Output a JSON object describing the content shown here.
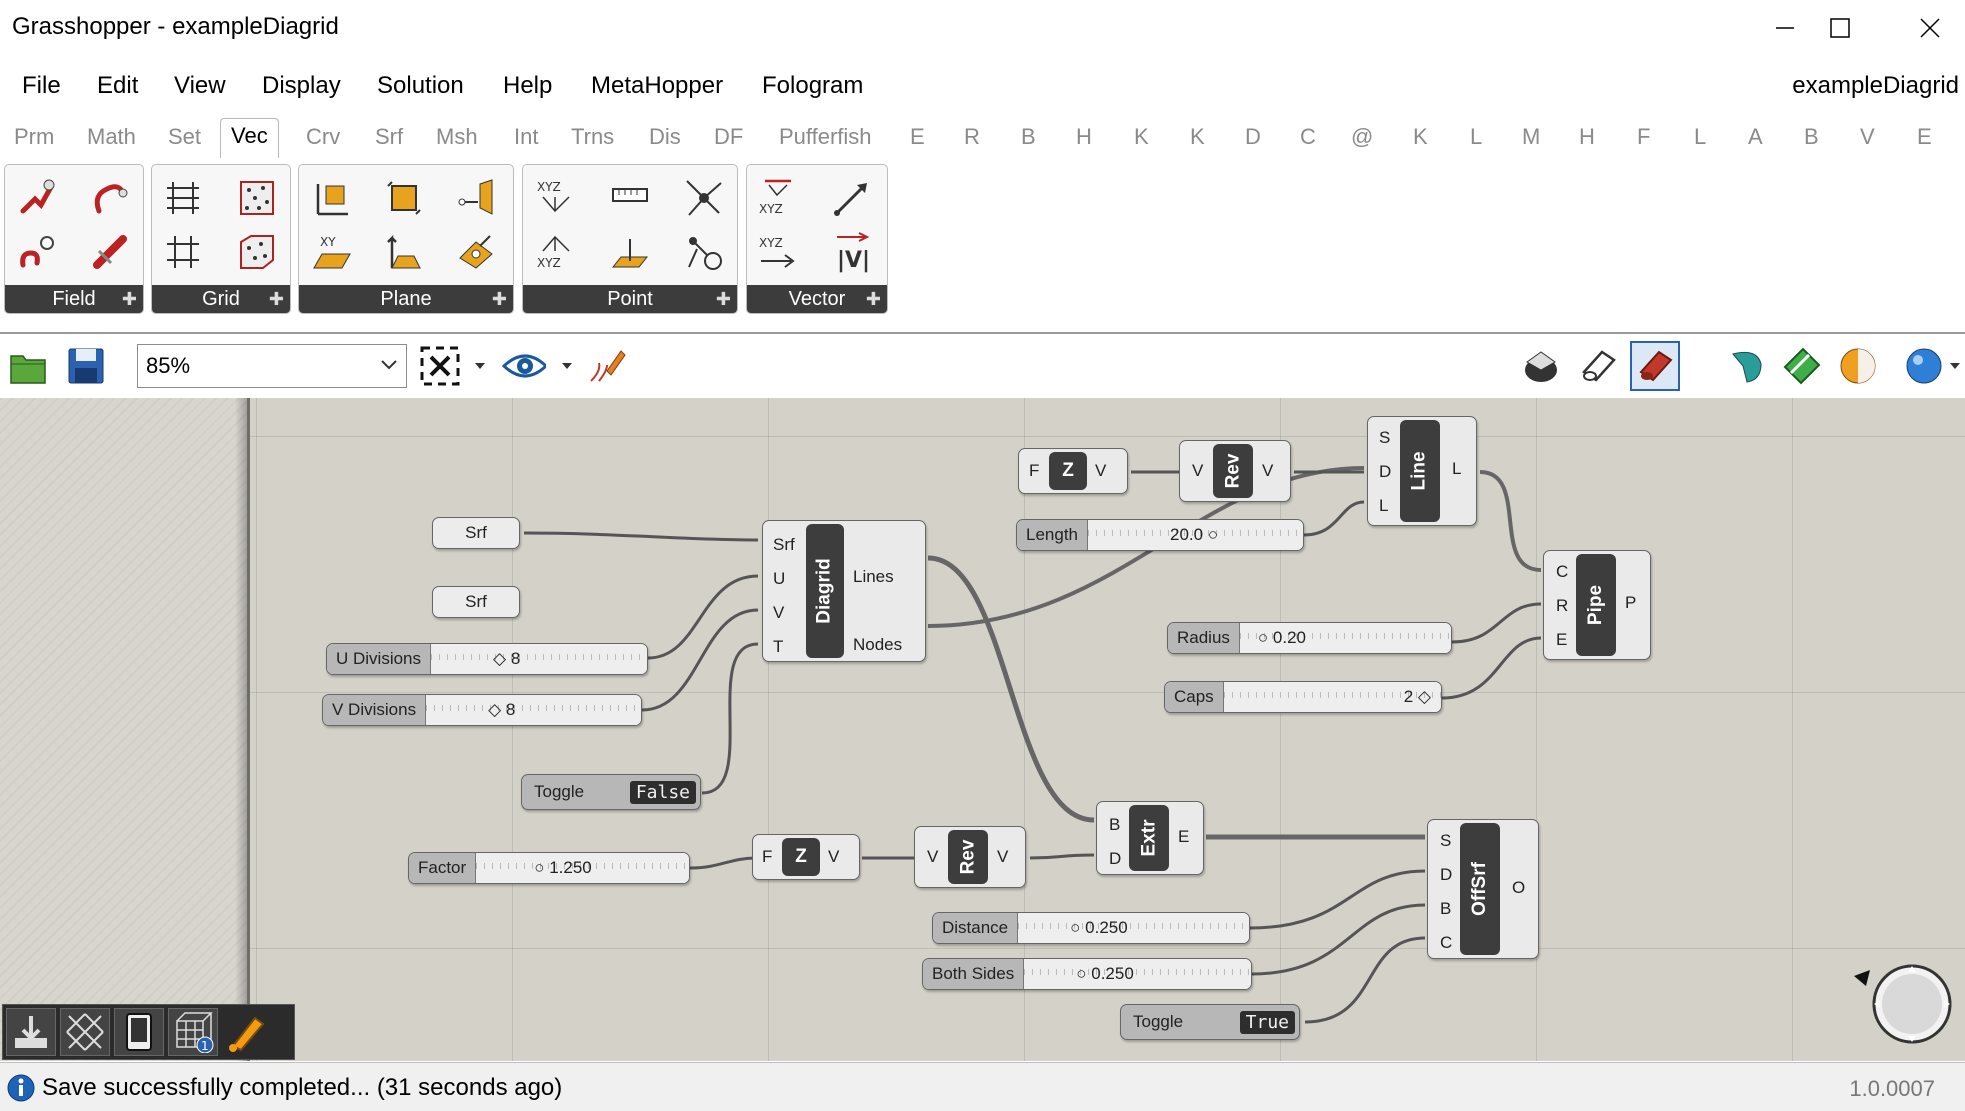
{
  "window": {
    "title": "Grasshopper - exampleDiagrid"
  },
  "menu": {
    "items": [
      "File",
      "Edit",
      "View",
      "Display",
      "Solution",
      "Help",
      "MetaHopper",
      "Fologram"
    ],
    "document_name": "exampleDiagrid"
  },
  "tabs": {
    "items": [
      "Prm",
      "Math",
      "Set",
      "Vec",
      "Crv",
      "Srf",
      "Msh",
      "Int",
      "Trns",
      "Dis",
      "DF",
      "Pufferfish",
      "E",
      "R",
      "B",
      "H",
      "K",
      "K",
      "D",
      "C",
      "@",
      "K",
      "L",
      "M",
      "H",
      "F",
      "L",
      "A",
      "B",
      "V",
      "E"
    ],
    "active": "Vec"
  },
  "ribbon": {
    "panels": [
      "Field",
      "Grid",
      "Plane",
      "Point",
      "Vector"
    ]
  },
  "toolbar": {
    "zoom": "85%"
  },
  "canvas": {
    "params": {
      "srf1": "Srf",
      "srf2": "Srf"
    },
    "sliders": {
      "u_divisions": {
        "label": "U Divisions",
        "value": "8"
      },
      "v_divisions": {
        "label": "V Divisions",
        "value": "8"
      },
      "length": {
        "label": "Length",
        "value": "20.0"
      },
      "radius": {
        "label": "Radius",
        "value": "0.20"
      },
      "caps": {
        "label": "Caps",
        "value": "2"
      },
      "factor": {
        "label": "Factor",
        "value": "1.250"
      },
      "distance": {
        "label": "Distance",
        "value": "0.250"
      },
      "both_sides": {
        "label": "Both Sides",
        "value": "0.250"
      }
    },
    "toggles": {
      "toggle1": {
        "label": "Toggle",
        "value": "False"
      },
      "toggle2": {
        "label": "Toggle",
        "value": "True"
      }
    },
    "components": {
      "diagrid": {
        "name": "Diagrid",
        "inputs": [
          "Srf",
          "U",
          "V",
          "T"
        ],
        "outputs": [
          "Lines",
          "Nodes"
        ]
      },
      "z1": {
        "name": "Z",
        "input": "F",
        "output": "V"
      },
      "rev1": {
        "name": "Rev",
        "input": "V",
        "output": "V"
      },
      "line": {
        "name": "Line",
        "inputs": [
          "S",
          "D",
          "L"
        ],
        "output": "L"
      },
      "pipe": {
        "name": "Pipe",
        "inputs": [
          "C",
          "R",
          "E"
        ],
        "output": "P"
      },
      "z2": {
        "name": "Z",
        "input": "F",
        "output": "V"
      },
      "rev2": {
        "name": "Rev",
        "input": "V",
        "output": "V"
      },
      "extr": {
        "name": "Extr",
        "inputs": [
          "B",
          "D"
        ],
        "output": "E"
      },
      "offsrf": {
        "name": "OffSrf",
        "inputs": [
          "S",
          "D",
          "B",
          "C"
        ],
        "output": "O"
      }
    }
  },
  "status": {
    "message": "Save successfully completed... (31 seconds ago)",
    "version": "1.0.0007"
  }
}
